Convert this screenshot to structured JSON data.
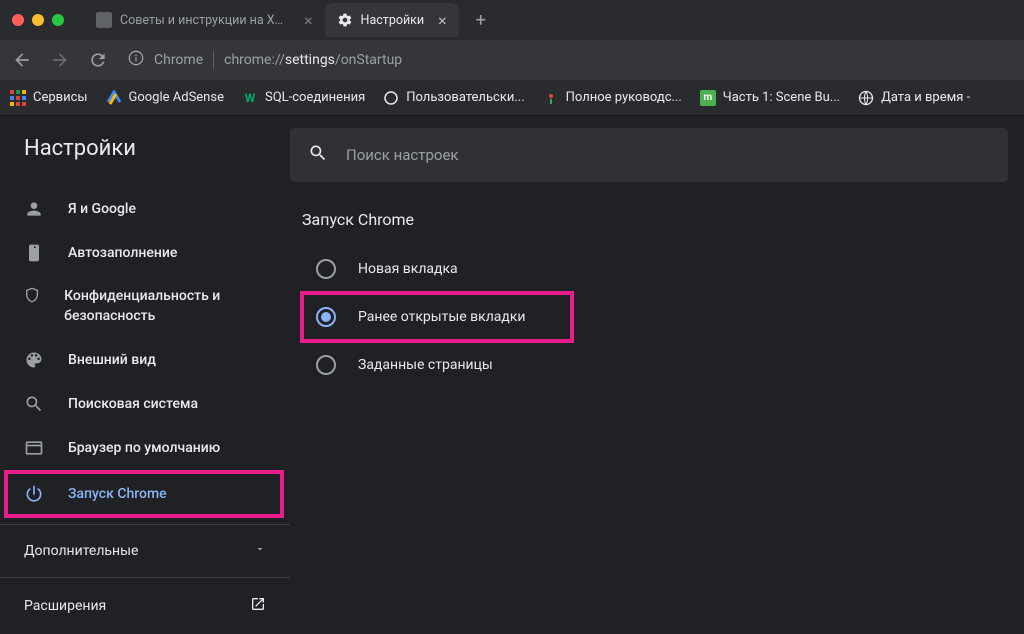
{
  "tabs": [
    {
      "title": "Советы и инструкции на XPC"
    },
    {
      "title": "Настройки"
    }
  ],
  "omnibox": {
    "prefix": "Chrome",
    "url_pre": "chrome://",
    "url_bold": "settings",
    "url_post": "/onStartup"
  },
  "bookmarks": [
    {
      "label": "Сервисы"
    },
    {
      "label": "Google AdSense"
    },
    {
      "label": "SQL-соединения"
    },
    {
      "label": "Пользовательски..."
    },
    {
      "label": "Полное руководс..."
    },
    {
      "label": "Часть 1: Scene Bu..."
    },
    {
      "label": "Дата и время -"
    }
  ],
  "settings_title": "Настройки",
  "search_placeholder": "Поиск настроек",
  "nav": [
    {
      "label": "Я и Google"
    },
    {
      "label": "Автозаполнение"
    },
    {
      "label": "Конфиденциальность и безопасность"
    },
    {
      "label": "Внешний вид"
    },
    {
      "label": "Поисковая система"
    },
    {
      "label": "Браузер по умолчанию"
    },
    {
      "label": "Запуск Chrome"
    }
  ],
  "advanced_label": "Дополнительные",
  "extensions_label": "Расширения",
  "section_title": "Запуск Chrome",
  "options": [
    {
      "label": "Новая вкладка"
    },
    {
      "label": "Ранее открытые вкладки"
    },
    {
      "label": "Заданные страницы"
    }
  ]
}
